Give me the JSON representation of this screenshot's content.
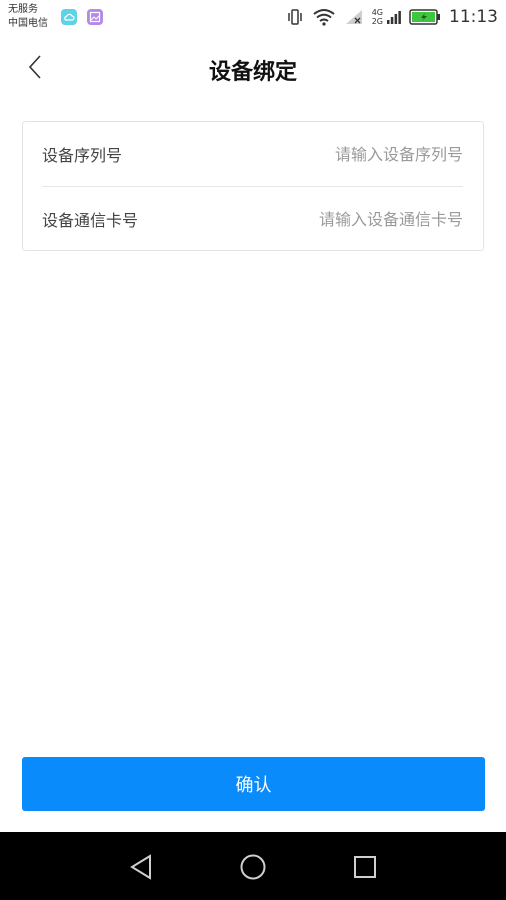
{
  "status_bar": {
    "carrier_line1": "无服务",
    "carrier_line2": "中国电信",
    "network_top": "4G",
    "network_bottom": "2G",
    "time": "11:13",
    "battery_color": "#3ec63e"
  },
  "header": {
    "title": "设备绑定"
  },
  "form": {
    "serial": {
      "label": "设备序列号",
      "placeholder": "请输入设备序列号",
      "value": ""
    },
    "sim": {
      "label": "设备通信卡号",
      "placeholder": "请输入设备通信卡号",
      "value": ""
    }
  },
  "actions": {
    "confirm_label": "确认",
    "accent_color": "#0a8bfb"
  },
  "nav_icons": [
    "back-triangle-icon",
    "home-circle-icon",
    "recent-square-icon"
  ]
}
